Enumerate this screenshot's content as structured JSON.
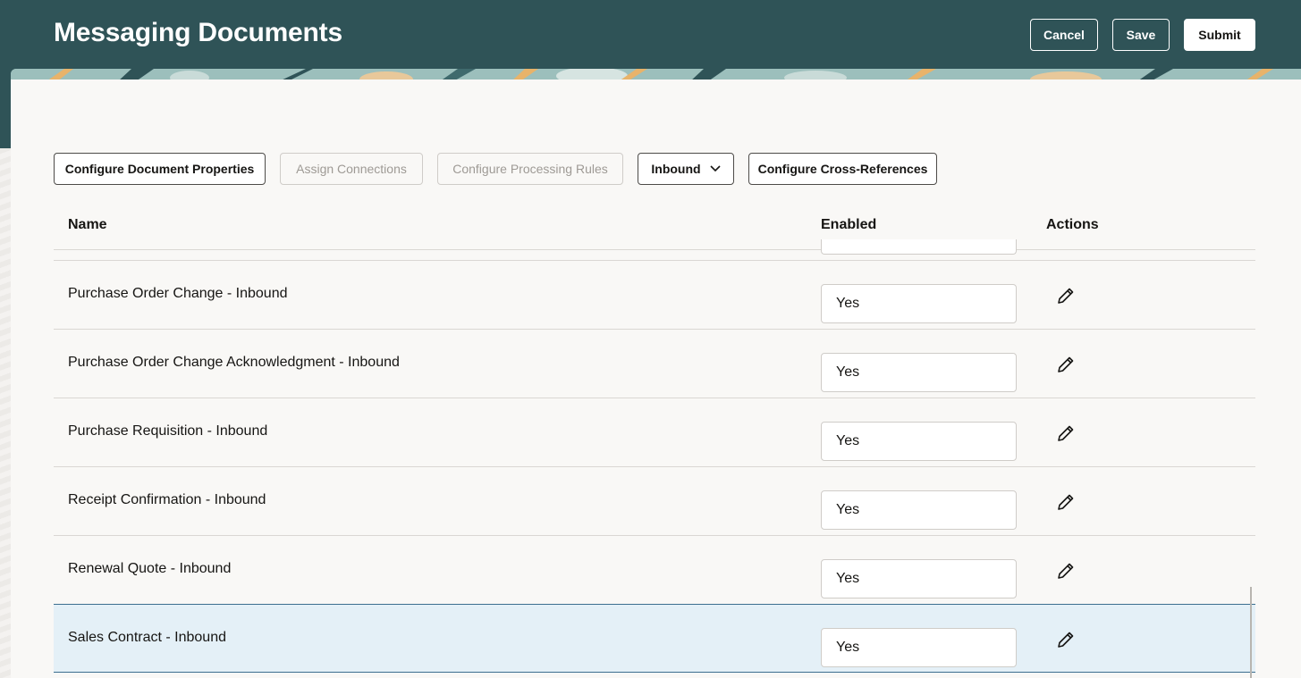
{
  "header": {
    "title": "Messaging Documents",
    "cancel_label": "Cancel",
    "save_label": "Save",
    "submit_label": "Submit"
  },
  "toolbar": {
    "configure_properties": "Configure Document Properties",
    "assign_connections": "Assign Connections",
    "configure_rules": "Configure Processing Rules",
    "direction_selected": "Inbound",
    "configure_xrefs": "Configure Cross-References"
  },
  "table": {
    "columns": {
      "name": "Name",
      "enabled": "Enabled",
      "actions": "Actions"
    },
    "rows": [
      {
        "name": "Purchase Order Change - Inbound",
        "enabled": "Yes"
      },
      {
        "name": "Purchase Order Change Acknowledgment - Inbound",
        "enabled": "Yes"
      },
      {
        "name": "Purchase Requisition - Inbound",
        "enabled": "Yes"
      },
      {
        "name": "Receipt Confirmation - Inbound",
        "enabled": "Yes"
      },
      {
        "name": "Renewal Quote - Inbound",
        "enabled": "Yes"
      },
      {
        "name": "Sales Contract - Inbound",
        "enabled": "Yes"
      }
    ],
    "selected_row_index": 5
  },
  "icons": {
    "edit": "pencil-icon",
    "dropdown": "chevron-down-icon"
  },
  "colors": {
    "header_bg": "#2f5357",
    "selected_row_bg": "#e4f0f7",
    "selected_row_border": "#3c6e8f"
  }
}
